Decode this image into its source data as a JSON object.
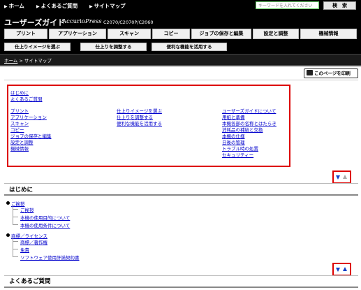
{
  "topbar": {
    "home": "ホーム",
    "faq": "よくあるご質問",
    "sitemap": "サイトマップ",
    "search_placeholder": "キーワードを入れてください",
    "search_button": "検　索"
  },
  "header": {
    "title": "ユーザーズガイド",
    "brand_accurio": "Accurio",
    "brand_press": "Press",
    "model": "C2070/C2070P/C2060"
  },
  "nav_main": [
    "プリント",
    "アプリケーション",
    "スキャン",
    "コピー",
    "ジョブの保存と編集",
    "設定と調整",
    "機械情報"
  ],
  "nav_sub": [
    "仕上りイメージを選ぶ",
    "仕上りを調整する",
    "便利な機能を活用する"
  ],
  "breadcrumb": {
    "home": "ホーム",
    "sep": ">",
    "current": "サイトマップ"
  },
  "print_button": "このページを印刷",
  "sitemap": {
    "top_links": [
      "はじめに",
      "よくあるご質問"
    ],
    "col1": [
      "プリント",
      "アプリケーション",
      "スキャン",
      "コピー",
      "ジョブの保存と編集",
      "設定と調整",
      "機械情報"
    ],
    "col2": [
      "仕上りイメージを選ぶ",
      "仕上りを調整する",
      "便利な機能を活用する"
    ],
    "col3": [
      "ユーザーズガイドについて",
      "用紙と準備",
      "本機各部の名称とはたらき",
      "消耗品の補給と交換",
      "本機の仕様",
      "日後の管理",
      "トラブル時の処置",
      "セキュリティー"
    ]
  },
  "section_intro": {
    "title": "はじめに",
    "groups": [
      {
        "label": "ご挨拶",
        "children": [
          "ご挨拶",
          "本機の使用目的について",
          "本機の使用条件について"
        ]
      },
      {
        "label": "商標／ライセンス",
        "children": [
          "商標／著作権",
          "免責",
          "ソフトウェア使用許諾契約書"
        ]
      }
    ]
  },
  "section_faq": {
    "title": "よくあるご質問"
  }
}
